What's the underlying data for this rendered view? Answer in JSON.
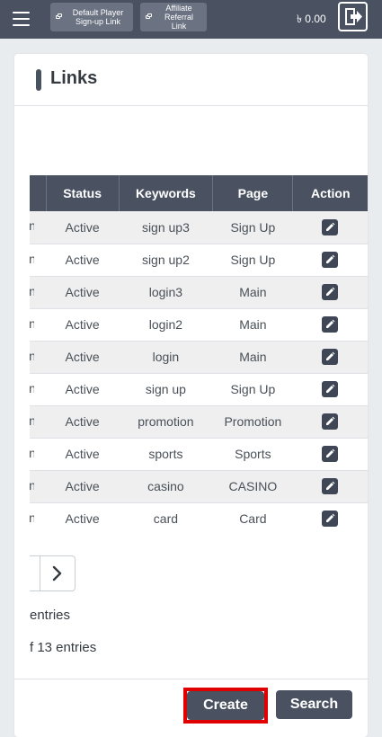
{
  "topbar": {
    "menu_icon": "hamburger-icon",
    "default_player_link": "Default Player\nSign-up Link",
    "affiliate_referral_link": "Affiliate\nReferral\nLink",
    "balance": "৳ 0.00",
    "logout_icon": "logout-icon"
  },
  "card": {
    "title": "Links"
  },
  "table": {
    "columns": [
      "Status",
      "Keywords",
      "Page",
      "Action"
    ],
    "clipped_column_tail": "n",
    "rows": [
      {
        "status": "Active",
        "keyword": "sign up3",
        "page": "Sign Up"
      },
      {
        "status": "Active",
        "keyword": "sign up2",
        "page": "Sign Up"
      },
      {
        "status": "Active",
        "keyword": "login3",
        "page": "Main"
      },
      {
        "status": "Active",
        "keyword": "login2",
        "page": "Main"
      },
      {
        "status": "Active",
        "keyword": "login",
        "page": "Main"
      },
      {
        "status": "Active",
        "keyword": "sign up",
        "page": "Sign Up"
      },
      {
        "status": "Active",
        "keyword": "promotion",
        "page": "Promotion"
      },
      {
        "status": "Active",
        "keyword": "sports",
        "page": "Sports"
      },
      {
        "status": "Active",
        "keyword": "casino",
        "page": "CASINO"
      },
      {
        "status": "Active",
        "keyword": "card",
        "page": "Card"
      }
    ],
    "action_icon": "edit-icon"
  },
  "pagination": {
    "next_icon": "chevron-right-icon"
  },
  "info": {
    "line1": "entries",
    "line2": "f 13 entries"
  },
  "buttons": {
    "create": "Create",
    "search": "Search"
  },
  "colors": {
    "header_bg": "#4a5262",
    "highlight": "#e00000"
  }
}
